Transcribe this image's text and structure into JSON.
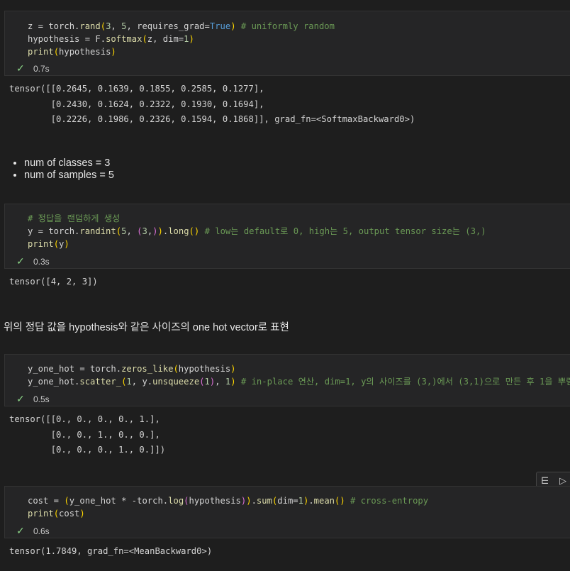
{
  "cells": [
    {
      "status_time": "0.7s",
      "output": "tensor([[0.2645, 0.1639, 0.1855, 0.2585, 0.1277],\n        [0.2430, 0.1624, 0.2322, 0.1930, 0.1694],\n        [0.2226, 0.1986, 0.2326, 0.1594, 0.1868]], grad_fn=<SoftmaxBackward0>)"
    },
    {
      "comment_line": "# 정답을 랜덤하게 생성",
      "status_time": "0.3s",
      "output": "tensor([4, 2, 3])"
    },
    {
      "status_time": "0.5s",
      "output": "tensor([[0., 0., 0., 0., 1.],\n        [0., 0., 1., 0., 0.],\n        [0., 0., 0., 1., 0.]])"
    },
    {
      "status_time": "0.6s",
      "output": "tensor(1.7849, grad_fn=<MeanBackward0>)"
    }
  ],
  "markdown": {
    "bullets": [
      "num of classes = 3",
      "num of samples = 5"
    ],
    "sentence": "위의 정답 값을 hypothesis와 같은 사이즈의 one hot vector로 표현"
  },
  "icons": {
    "status": "check-icon",
    "toolbar": [
      "run-by-line-icon",
      "run-icon"
    ]
  },
  "colors": {
    "background": "#1e1e1e",
    "cell": "#252526",
    "success": "#89d185",
    "comment": "#6a9955"
  }
}
